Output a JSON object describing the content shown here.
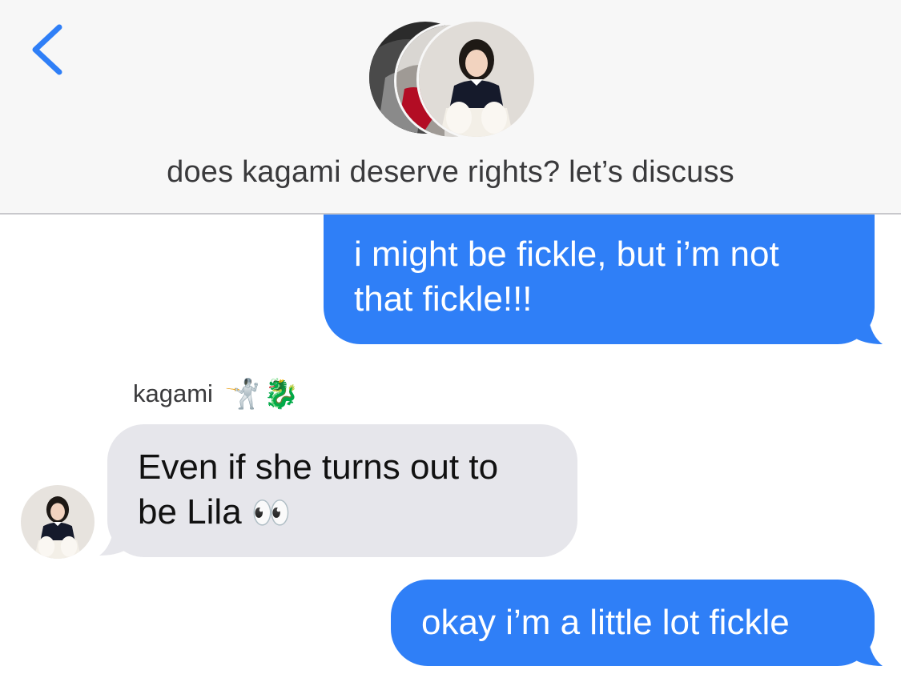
{
  "header": {
    "back_icon": "chevron-left-icon",
    "title": "does kagami deserve rights? let’s discuss",
    "accent": "#2f7ff7"
  },
  "messages": [
    {
      "direction": "outgoing",
      "line1": "i might be fickle, but i’m not",
      "line2": "that fickle!!!"
    },
    {
      "direction": "incoming",
      "sender": "kagami",
      "sender_emojis": [
        "🤺",
        "🐉"
      ],
      "line1": "Even if she turns out to",
      "line2": "be Lila",
      "emoji": "👀"
    },
    {
      "direction": "outgoing",
      "line1": "okay i’m a little lot fickle"
    }
  ],
  "colors": {
    "outgoing_bubble": "#2f7ff7",
    "incoming_bubble": "#e6e6eb",
    "header_bg": "#f7f7f7"
  }
}
